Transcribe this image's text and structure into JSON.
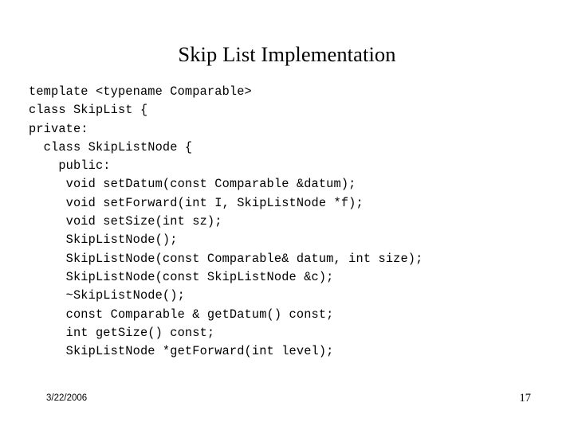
{
  "slide": {
    "title": "Skip List Implementation",
    "background_color": "#ffffff",
    "text_color": "#000000",
    "code_lines": [
      "template <typename Comparable>",
      "class SkipList {",
      "private:",
      "  class SkipListNode {",
      "    public:",
      "     void setDatum(const Comparable &datum);",
      "     void setForward(int I, SkipListNode *f);",
      "     void setSize(int sz);",
      "     SkipListNode();",
      "     SkipListNode(const Comparable& datum, int size);",
      "     SkipListNode(const SkipListNode &c);",
      "     ~SkipListNode();",
      "     const Comparable & getDatum() const;",
      "     int getSize() const;",
      "     SkipListNode *getForward(int level);"
    ],
    "footer": {
      "date": "3/22/2006",
      "page_number": "17"
    }
  }
}
